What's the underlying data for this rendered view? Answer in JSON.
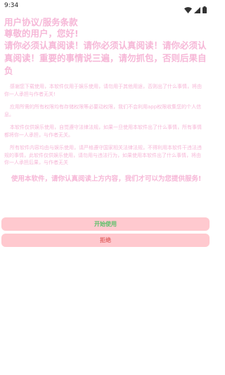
{
  "status": {
    "time": "9:34",
    "icons": [
      "wifi-icon",
      "signal-icon",
      "battery-icon"
    ]
  },
  "agreement": {
    "title": "用户协议/服务条款",
    "greeting": "尊敬的用户，您好!",
    "warning": "请你必须认真阅读！请你必须认真阅读！请你必须认真阅读！重要的事情说三遍，请勿抓包，否则后果自负",
    "paragraphs": [
      "感谢您下载使用，本软件仅用于娱乐使用，请勿用于其他用途，否则出了什么事情，将由你一人承担与作者无关!",
      "应用所需的所有权限均有存储权限等必要动权限，我们不会利用app权限收集您的个人信息。",
      "本软件仅供娱乐使用，自觉遵守法律法规，如果一旦使用本软件出了什么事情，所有事情都将你一人承担，与作者无关。",
      "所有软件内容均由与娱乐使用，请严格遵守国家相关法律法规，不得利用本软件干违法违规的事情，此软件仅供娱乐使用，请勿用与违法行为，如果使用本软件出了什么事情，将由你一人承担后果，与作者无关"
    ],
    "closing": "使用本软件，请你认真阅读上方内容，我们才可以为您提供服务!"
  },
  "buttons": {
    "start_label": "开始使用",
    "reject_label": "拒绝"
  },
  "colors": {
    "text_pink": "#f6b7d7",
    "button_bg": "#ffc9cf",
    "start_text": "#5cc06a",
    "reject_text": "#e36a6a"
  }
}
